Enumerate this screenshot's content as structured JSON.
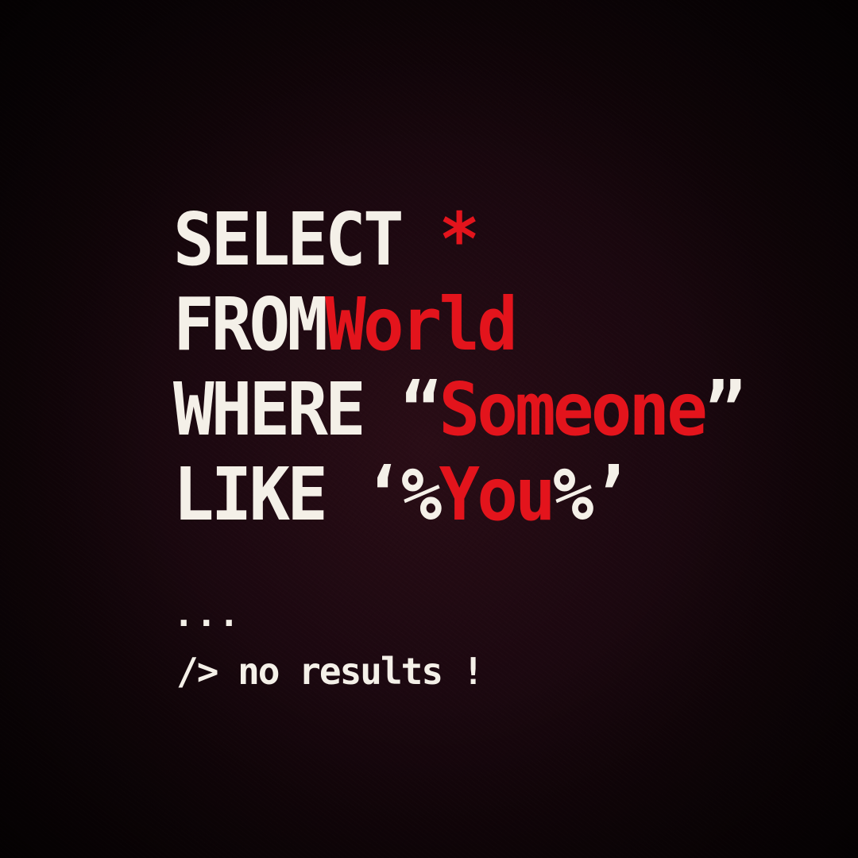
{
  "query": {
    "select_keyword": "SELECT",
    "select_target": "*",
    "from_keyword": "FROM",
    "from_target": "World",
    "where_keyword": "WHERE",
    "where_open_quote": "“",
    "where_value": "Someone",
    "where_close_quote": "”",
    "like_keyword": "LIKE",
    "like_prefix": "‘%",
    "like_value": "You",
    "like_suffix": "%’"
  },
  "output": {
    "ellipsis": "...",
    "result_prompt": "/>",
    "result_text": "no results",
    "result_mark": "!"
  },
  "colors": {
    "keyword": "#f4f0e8",
    "highlight": "#e3141c",
    "background": "#1c0810"
  }
}
